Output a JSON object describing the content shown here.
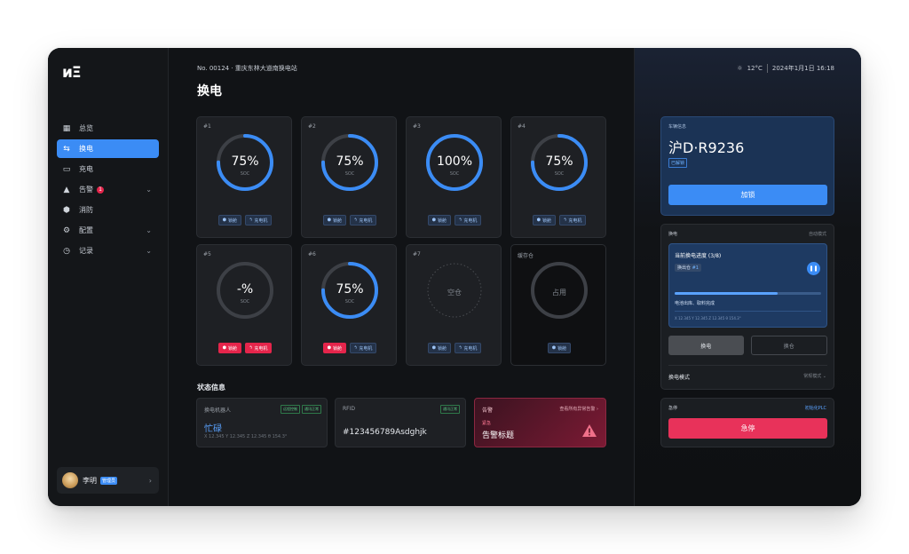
{
  "app": {
    "logo": "ᴎΞ"
  },
  "sidebar": {
    "items": [
      {
        "label": "总览",
        "icon": "dashboard-icon"
      },
      {
        "label": "换电",
        "icon": "swap-icon",
        "active": true
      },
      {
        "label": "充电",
        "icon": "battery-icon"
      },
      {
        "label": "告警",
        "icon": "warning-icon",
        "badge": "1"
      },
      {
        "label": "消防",
        "icon": "shield-icon"
      },
      {
        "label": "配置",
        "icon": "gear-icon"
      },
      {
        "label": "记录",
        "icon": "clock-icon"
      }
    ],
    "user": {
      "name": "李明",
      "role": "管理员"
    }
  },
  "header": {
    "station": "No. 00124 · 重庆东林大道南换电站",
    "title": "换电",
    "weather": "12°C",
    "datetime": "2024年1月1日  16:18"
  },
  "slots": [
    {
      "num": "#1",
      "pct": "75%",
      "soc": "SOC",
      "fill": 0.75,
      "b1": "锁舱",
      "b2": "充电机",
      "red": false
    },
    {
      "num": "#2",
      "pct": "75%",
      "soc": "SOC",
      "fill": 0.75,
      "b1": "锁舱",
      "b2": "充电机",
      "red": false
    },
    {
      "num": "#3",
      "pct": "100%",
      "soc": "SOC",
      "fill": 1.0,
      "b1": "锁舱",
      "b2": "充电机",
      "red": false
    },
    {
      "num": "#4",
      "pct": "75%",
      "soc": "SOC",
      "fill": 0.75,
      "b1": "锁舱",
      "b2": "充电机",
      "red": false
    },
    {
      "num": "#5",
      "pct": "-%",
      "soc": "SOC",
      "fill": 0,
      "b1": "锁舱",
      "b2": "充电机",
      "red": true
    },
    {
      "num": "#6",
      "pct": "75%",
      "soc": "SOC",
      "fill": 0.75,
      "b1": "锁舱",
      "b2": "充电机",
      "red": "first"
    },
    {
      "num": "#7",
      "center": "空仓",
      "b1": "锁舱",
      "b2": "充电机",
      "empty": true
    },
    {
      "num": "缓存仓",
      "center": "占用",
      "b1": "锁舱",
      "occupied": true
    }
  ],
  "status": {
    "title": "状态信息",
    "robot": {
      "label": "换电机器人",
      "pill1": "远程控制",
      "pill2": "通讯正常",
      "value": "忙碌",
      "xyz": "X 12.345   Y 12.345   Z 12.345   θ 154.3°"
    },
    "rfid": {
      "label": "RFID",
      "pill": "通讯正常",
      "value": "#123456789Asdghjk"
    },
    "alarm": {
      "label": "告警",
      "link": "查看所有异常告警 ›",
      "level": "紧急",
      "title": "告警标题"
    }
  },
  "vehicle": {
    "label": "车辆信息",
    "plate": "沪D·R9236",
    "state": "已解锁",
    "action": "加锁"
  },
  "swap": {
    "label": "换电",
    "mode": "自动模式",
    "progress_title": "当前换电进度 (3/8)",
    "chip_prefix": "换出仓",
    "chip_slot": "#1",
    "progress": 0.7,
    "step": "电池出库、取料完成",
    "xyz": "X 12.345   Y 12.345   Z 12.345   θ 154.3°",
    "tab_on": "换电",
    "tab_off": "换仓",
    "mode_label": "换电模式",
    "mode_value": "常规模式"
  },
  "estop": {
    "label": "急停",
    "init": "初始化PLC",
    "action": "急停"
  },
  "colors": {
    "accent": "#3b8cf5",
    "danger": "#e5254b"
  }
}
